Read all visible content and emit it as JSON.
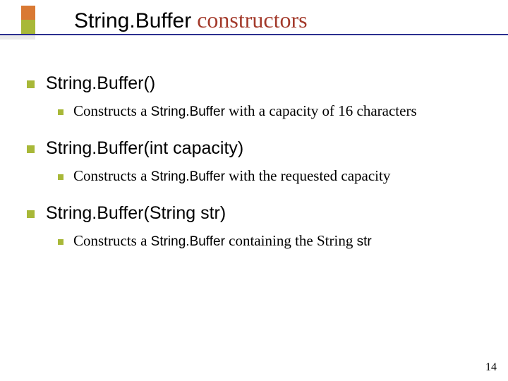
{
  "title": {
    "main": "String.Buffer",
    "sub": " constructors"
  },
  "items": [
    {
      "heading": "String.Buffer()",
      "desc_pre": "Constructs a ",
      "desc_code": "String.Buffer",
      "desc_post": " with a capacity of 16 characters"
    },
    {
      "heading": "String.Buffer(int capacity)",
      "desc_pre": "Constructs a ",
      "desc_code": "String.Buffer",
      "desc_post": " with the requested capacity"
    },
    {
      "heading": "String.Buffer(String str)",
      "desc_pre": "Constructs a ",
      "desc_code": "String.Buffer",
      "desc_post_a": " containing the String ",
      "desc_post_b": "str"
    }
  ],
  "page_number": "14"
}
